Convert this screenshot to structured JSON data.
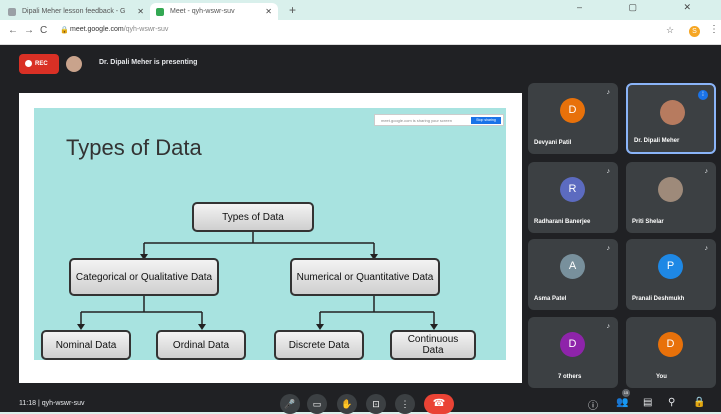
{
  "browser": {
    "tab1_title": "Dipali Meher lesson feedback - G",
    "tab2_title": "Meet - qyh-wswr-suv",
    "tab_close": "✕",
    "new_tab": "+",
    "window_buttons": "–  ▢  ✕",
    "back": "←",
    "forward": "→",
    "reload": "C",
    "lock": "🔒",
    "url_host": "meet.google.com",
    "url_path": "/qyh-wswr-suv",
    "star": "☆",
    "extension": "S",
    "menu": "⋮"
  },
  "meet": {
    "rec_label": "REC",
    "presenting_text": "Dr. Dipali Meher is presenting",
    "share_bar_text": "meet.google.com is sharing your screen",
    "stop_sharing_label": "Stop sharing",
    "meeting_time": "11:18",
    "meeting_code": "qyh-wswr-suv",
    "clock_separator": "|"
  },
  "slide": {
    "title": "Types of Data",
    "nodes": {
      "root": "Types of Data",
      "categorical": "Categorical or Qualitative Data",
      "numerical": "Numerical or Quantitative Data",
      "nominal": "Nominal Data",
      "ordinal": "Ordinal Data",
      "discrete": "Discrete Data",
      "continuous": "Continuous Data"
    }
  },
  "participants": [
    {
      "name": "Devyani Patil",
      "initial": "D",
      "color": "#e8710a"
    },
    {
      "name": "Dr. Dipali Meher",
      "initial": "",
      "color": "#b77b5f"
    },
    {
      "name": "Radharani Banerjee",
      "initial": "R",
      "color": "#5c6bc0"
    },
    {
      "name": "Priti Shelar",
      "initial": "",
      "color": "#9e8a7a"
    },
    {
      "name": "Asma Patel",
      "initial": "A",
      "color": "#78909c"
    },
    {
      "name": "Pranali Deshmukh",
      "initial": "P",
      "color": "#1e88e5"
    },
    {
      "name": "7 others",
      "initial": "D",
      "color": "#8e24aa"
    },
    {
      "name": "You",
      "initial": "D",
      "color": "#e8710a"
    }
  ],
  "controls": {
    "mic": "🎤",
    "camera": "▭",
    "raise_hand": "✋",
    "present": "⊡",
    "more": "⋮",
    "end_call": "☎",
    "info": "ⓘ",
    "people": "👥",
    "people_count": "15",
    "chat": "▤",
    "activities": "⚲",
    "host_controls": "🔒",
    "mic_off": "♪",
    "speaking": "⁞"
  }
}
